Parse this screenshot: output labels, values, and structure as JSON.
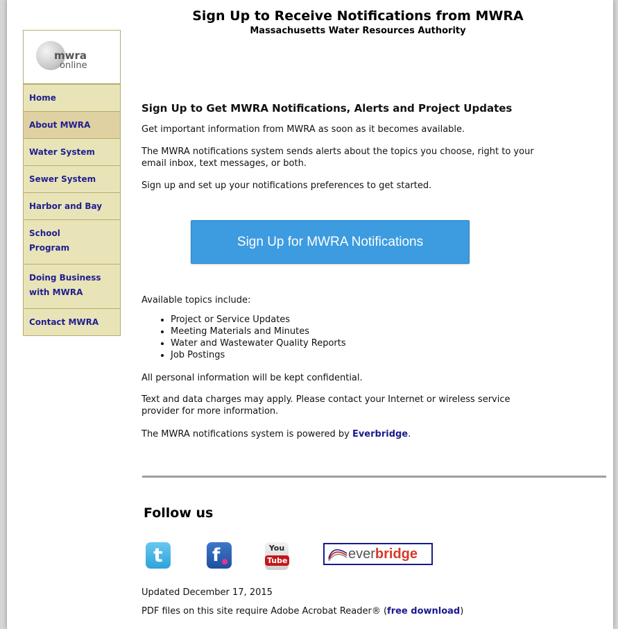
{
  "header": {
    "title": "Sign Up to Receive Notifications from MWRA",
    "subtitle": "Massachusetts Water Resources Authority"
  },
  "logo": {
    "line1": "mwra",
    "line2": "online"
  },
  "sidebar": {
    "items": [
      {
        "label": "Home"
      },
      {
        "label": "About MWRA"
      },
      {
        "label": "Water System"
      },
      {
        "label": "Sewer System"
      },
      {
        "label": "Harbor and Bay"
      },
      {
        "label_line1": "School",
        "label_line2": "Program"
      },
      {
        "label_line1": "Doing Business",
        "label_line2": "with MWRA"
      },
      {
        "label": "Contact MWRA"
      }
    ]
  },
  "main": {
    "heading": "Sign Up to Get MWRA Notifications, Alerts and Project Updates",
    "intro": "Get important information from MWRA as soon as it becomes available.",
    "desc_line1": "The MWRA notifications system sends alerts about the topics you choose, right to your",
    "desc_line2": "email inbox, text messages, or both.",
    "setup": "Sign up and set up your notifications preferences to get started.",
    "signup_button": "Sign Up for MWRA Notifications",
    "topics_intro": "Available topics include:",
    "topics": [
      "Project or Service Updates",
      "Meeting Materials and Minutes",
      "Water and Wastewater Quality Reports",
      "Job Postings"
    ],
    "confidential": "All personal information will be kept confidential.",
    "charges_line1": "Text and data charges may apply. Please contact your Internet or wireless service",
    "charges_line2": "provider for more information.",
    "powered_prefix": "The MWRA notifications system is powered by ",
    "powered_link": "Everbridge",
    "powered_suffix": "."
  },
  "footer": {
    "follow_title": "Follow us",
    "social": {
      "twitter_glyph": "t",
      "flickr_glyph": "f",
      "youtube_you": "You",
      "youtube_tube": "Tube",
      "everbridge_a": "ever",
      "everbridge_b": "bridge"
    },
    "updated": "Updated December 17, 2015",
    "pdf_prefix": "PDF files on this site require Adobe Acrobat Reader® (",
    "pdf_link": "free download",
    "pdf_suffix": ")"
  },
  "colors": {
    "sidebar_bg": "#e9e4b8",
    "sidebar_active": "#dfd1a2",
    "nav_text": "#1f1f8f",
    "button_bg": "#3d9be0",
    "link": "#1a1a8c"
  }
}
